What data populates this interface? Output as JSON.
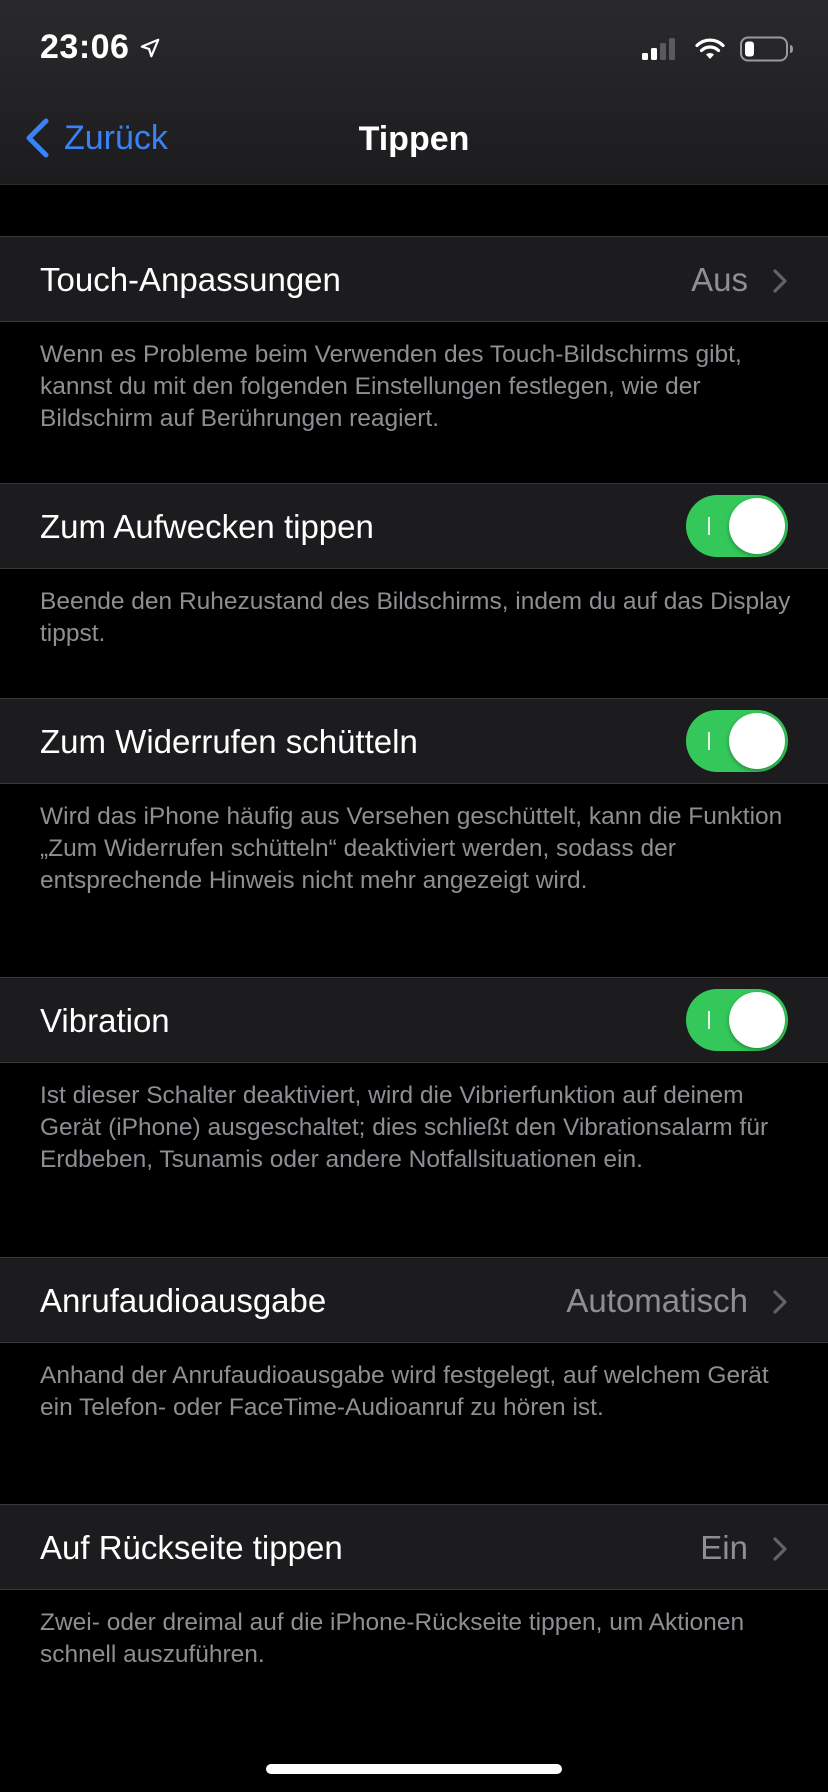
{
  "status_bar": {
    "time": "23:06",
    "icons": [
      "location-arrow-icon",
      "cellular-signal-icon",
      "wifi-icon",
      "battery-icon"
    ]
  },
  "nav": {
    "back_label": "Zurück",
    "title": "Tippen"
  },
  "colors": {
    "accent": "#3a82f7",
    "toggle_on": "#34c759",
    "cell_background": "#1c1c1e",
    "secondary_text": "#8e8e93"
  },
  "rows": [
    {
      "label": "Touch-Anpassungen",
      "type": "disclosure",
      "value": "Aus",
      "footer": "Wenn es Probleme beim Verwenden des Touch-Bildschirms gibt, kannst du mit den folgenden Einstellungen festlegen, wie der Bildschirm auf Berührungen reagiert."
    },
    {
      "label": "Zum Aufwecken tippen",
      "type": "toggle",
      "on": true,
      "footer": "Beende den Ruhezustand des Bildschirms, indem du auf das Display tippst."
    },
    {
      "label": "Zum Widerrufen schütteln",
      "type": "toggle",
      "on": true,
      "footer": "Wird das iPhone häufig aus Versehen geschüttelt, kann die Funktion „Zum Widerrufen schütteln“ deaktiviert werden, sodass der entsprechende Hinweis nicht mehr angezeigt wird."
    },
    {
      "label": "Vibration",
      "type": "toggle",
      "on": true,
      "footer": "Ist dieser Schalter deaktiviert, wird die Vibrierfunktion auf deinem Gerät (iPhone) ausgeschaltet; dies schließt den Vibrationsalarm für Erdbeben, Tsunamis oder andere Notfallsituationen ein."
    },
    {
      "label": "Anrufaudioausgabe",
      "type": "disclosure",
      "value": "Automatisch",
      "footer": "Anhand der Anrufaudioausgabe wird festgelegt, auf welchem Gerät ein Telefon- oder FaceTime-Audioanruf zu hören ist."
    },
    {
      "label": "Auf Rückseite tippen",
      "type": "disclosure",
      "value": "Ein",
      "footer": "Zwei- oder dreimal auf die iPhone-Rückseite tippen, um Aktionen schnell auszuführen."
    }
  ]
}
